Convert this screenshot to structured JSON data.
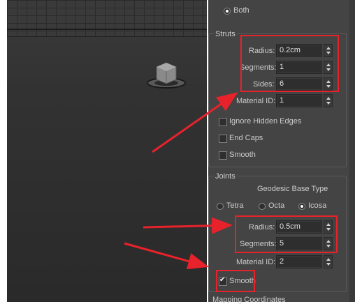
{
  "top_radio": {
    "label": "Both"
  },
  "struts": {
    "title": "Struts",
    "radius": {
      "label": "Radius:",
      "value": "0.2cm"
    },
    "segments": {
      "label": "Segments:",
      "value": "1"
    },
    "sides": {
      "label": "Sides:",
      "value": "6"
    },
    "material_id": {
      "label": "Material ID:",
      "value": "1"
    },
    "ignore_hidden_edges": {
      "label": "Ignore Hidden Edges",
      "checked": false
    },
    "end_caps": {
      "label": "End Caps",
      "checked": false
    },
    "smooth": {
      "label": "Smooth",
      "checked": false
    }
  },
  "joints": {
    "title": "Joints",
    "base_type_label": "Geodesic Base Type",
    "base_types": [
      {
        "label": "Tetra",
        "selected": false
      },
      {
        "label": "Octa",
        "selected": false
      },
      {
        "label": "Icosa",
        "selected": true
      }
    ],
    "radius": {
      "label": "Radius:",
      "value": "0.5cm"
    },
    "segments": {
      "label": "Segments:",
      "value": "5"
    },
    "material_id": {
      "label": "Material ID:",
      "value": "2"
    },
    "smooth": {
      "label": "Smooth",
      "checked": true
    }
  },
  "next_group_title": "Mapping Coordinates",
  "colors": {
    "highlight": "#e8222b",
    "panel_bg": "#444444",
    "field_bg": "#2e2e2e"
  }
}
